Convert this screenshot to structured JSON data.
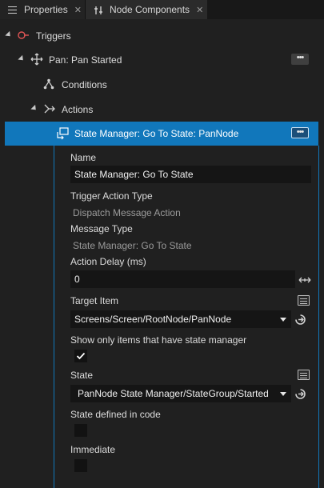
{
  "tabs": [
    {
      "label": "Properties",
      "close": "✕",
      "icon": "list-icon"
    },
    {
      "label": "Node Components",
      "close": "✕",
      "icon": "node-components-icon"
    }
  ],
  "tree": {
    "triggers": "Triggers",
    "pan": "Pan: Pan Started",
    "conditions": "Conditions",
    "actions": "Actions",
    "state_manager": "State Manager: Go To State: PanNode",
    "more": "•••"
  },
  "props": {
    "name_label": "Name",
    "name_value": "State Manager: Go To State",
    "trigger_type_label": "Trigger Action Type",
    "trigger_type_value": "Dispatch Message Action",
    "message_type_label": "Message Type",
    "message_type_value": "State Manager: Go To State",
    "delay_label": "Action Delay (ms)",
    "delay_value": "0",
    "target_label": "Target Item",
    "target_value": "Screens/Screen/RootNode/PanNode",
    "show_only_label": "Show only items that have state manager",
    "show_only_checked": true,
    "state_label": "State",
    "state_value": "PanNode State Manager/StateGroup/Started",
    "state_in_code_label": "State defined in code",
    "state_in_code_checked": false,
    "immediate_label": "Immediate",
    "immediate_checked": false
  },
  "colors": {
    "accent": "#1177bb",
    "background": "#202020",
    "field": "#151515"
  }
}
